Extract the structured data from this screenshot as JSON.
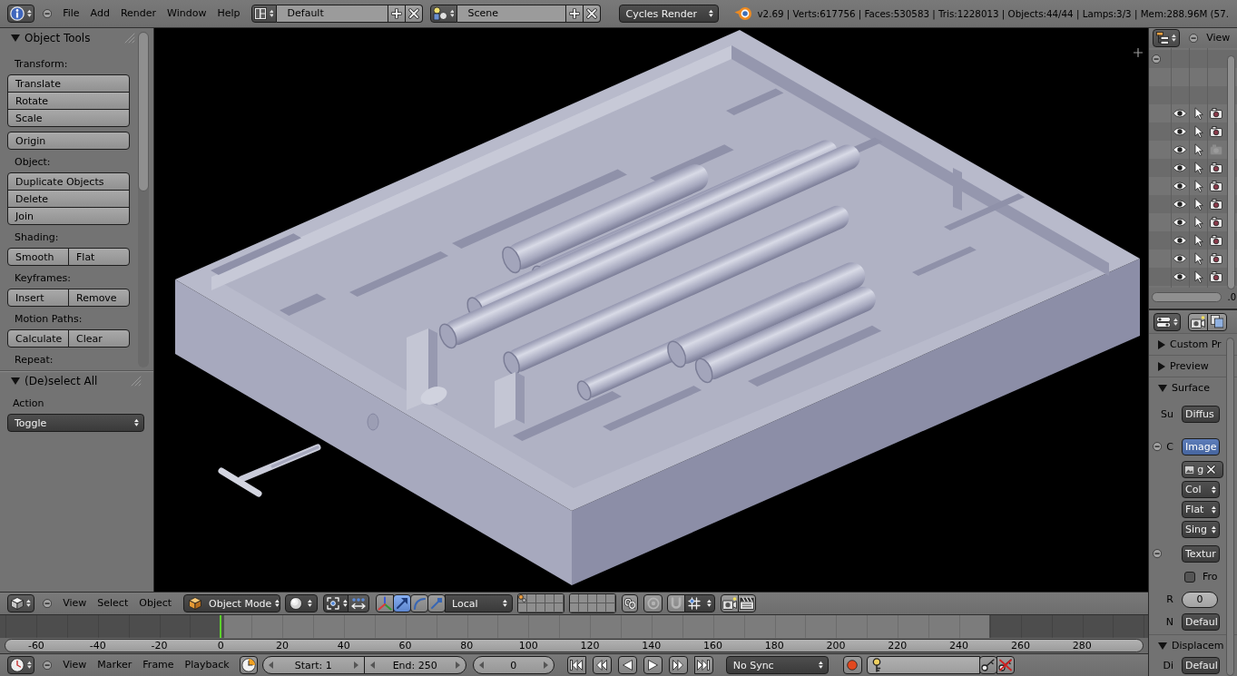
{
  "top_bar": {
    "menus": [
      "File",
      "Add",
      "Render",
      "Window",
      "Help"
    ],
    "screen_layout": "Default",
    "scene": "Scene",
    "render_engine": "Cycles Render",
    "stats": "v2.69 | Verts:617756 | Faces:530583 | Tris:1228013 | Objects:44/44 | Lamps:3/3 | Mem:288.96M (57."
  },
  "tool_shelf": {
    "panels": [
      {
        "title": "Object Tools",
        "expanded": true,
        "items": [
          {
            "kind": "label",
            "text": "Transform:"
          },
          {
            "kind": "column",
            "buttons": [
              "Translate",
              "Rotate",
              "Scale"
            ]
          },
          {
            "kind": "column",
            "buttons": [
              "Origin"
            ]
          },
          {
            "kind": "label",
            "text": "Object:"
          },
          {
            "kind": "column",
            "buttons": [
              "Duplicate Objects",
              "Delete",
              "Join"
            ]
          },
          {
            "kind": "label",
            "text": "Shading:"
          },
          {
            "kind": "row",
            "buttons": [
              "Smooth",
              "Flat"
            ]
          },
          {
            "kind": "label",
            "text": "Keyframes:"
          },
          {
            "kind": "row",
            "buttons": [
              "Insert",
              "Remove"
            ]
          },
          {
            "kind": "label",
            "text": "Motion Paths:"
          },
          {
            "kind": "row",
            "buttons": [
              "Calculate",
              "Clear"
            ]
          },
          {
            "kind": "label",
            "text": "Repeat:"
          }
        ]
      },
      {
        "title": "(De)select All",
        "expanded": true,
        "items": [
          {
            "kind": "label",
            "text": "Action"
          },
          {
            "kind": "dropdown",
            "value": "Toggle"
          }
        ]
      }
    ]
  },
  "viewport_header": {
    "menus": [
      "View",
      "Select",
      "Object"
    ],
    "mode": "Object Mode",
    "manipulators": [
      {
        "kind": "translate",
        "selected": true
      },
      {
        "kind": "rotate",
        "selected": false
      },
      {
        "kind": "scale",
        "selected": false
      }
    ],
    "orientation": "Local",
    "layers": [
      {
        "has_objects": true
      },
      {
        "has_objects": false
      },
      {
        "has_objects": false
      },
      {
        "has_objects": false
      },
      {
        "has_objects": false
      },
      {
        "has_objects": false
      },
      {
        "has_objects": false
      },
      {
        "has_objects": false
      },
      {
        "has_objects": false
      },
      {
        "has_objects": false
      },
      {
        "has_objects": false
      },
      {
        "has_objects": false
      },
      {
        "has_objects": false
      },
      {
        "has_objects": false
      },
      {
        "has_objects": false
      },
      {
        "has_objects": false
      },
      {
        "has_objects": false
      },
      {
        "has_objects": false
      },
      {
        "has_objects": false
      },
      {
        "has_objects": false
      }
    ]
  },
  "timeline": {
    "ruler": [
      "-60",
      "-40",
      "-20",
      "0",
      "20",
      "40",
      "60",
      "80",
      "100",
      "120",
      "140",
      "160",
      "180",
      "200",
      "220",
      "240",
      "260",
      "280"
    ]
  },
  "timeline_header": {
    "menus": [
      "View",
      "Marker",
      "Frame",
      "Playback"
    ],
    "start": "Start: 1",
    "end": "End: 250",
    "current_frame": "0",
    "sync": "No Sync"
  },
  "outliner": {
    "menu": "View",
    "rows": [
      {
        "renderable": true
      },
      {
        "renderable": true
      },
      {
        "renderable": false
      },
      {
        "renderable": true
      },
      {
        "renderable": true
      },
      {
        "renderable": true
      },
      {
        "renderable": true
      },
      {
        "renderable": true
      },
      {
        "renderable": true
      },
      {
        "renderable": true
      }
    ],
    "cut_text": ".0"
  },
  "properties": {
    "panels": [
      {
        "title": "Custom Pr",
        "expanded": false
      },
      {
        "title": "Preview",
        "expanded": false
      },
      {
        "title": "Surface",
        "expanded": true,
        "rows": [
          {
            "kind": "button",
            "label": "Su",
            "value": "Diffus",
            "collapsible": false
          },
          {
            "kind": "linked",
            "label": "C",
            "value": "Image",
            "collapsible": true
          },
          {
            "kind": "image_field",
            "value": "g",
            "collapsible": false
          },
          {
            "kind": "dropdown",
            "value": "Col",
            "collapsible": false
          },
          {
            "kind": "dropdown",
            "value": "Flat",
            "collapsible": false
          },
          {
            "kind": "dropdown",
            "value": "Sing",
            "collapsible": false
          },
          {
            "kind": "button",
            "value": "Textur",
            "collapsible": true
          },
          {
            "kind": "checkbox",
            "value": "Fro",
            "checked": false,
            "collapsible": false
          },
          {
            "kind": "number",
            "label": "R",
            "value": "0",
            "collapsible": false
          },
          {
            "kind": "button",
            "label": "N",
            "value": "Defaul",
            "collapsible": false
          }
        ]
      },
      {
        "title": "Displacem",
        "expanded": true,
        "rows": [
          {
            "kind": "button",
            "label": "Di",
            "value": "Defaul",
            "collapsible": false
          }
        ]
      }
    ]
  }
}
